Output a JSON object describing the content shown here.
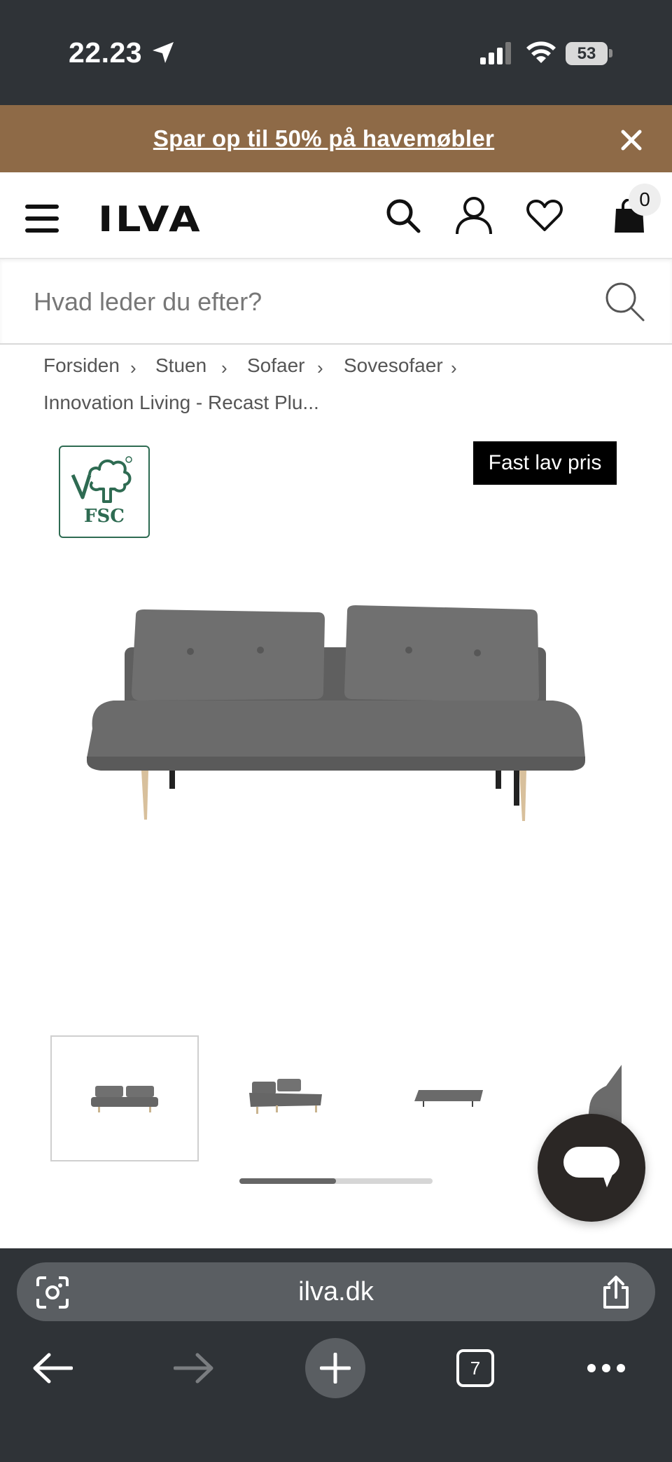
{
  "status_bar": {
    "time": "22.23",
    "battery": "53"
  },
  "promo": {
    "text": "Spar op til 50% på havemøbler"
  },
  "header": {
    "logo": "ILVA",
    "cart_count": "0"
  },
  "search": {
    "placeholder": "Hvad leder du efter?"
  },
  "breadcrumb": {
    "items": [
      "Forsiden",
      "Stuen",
      "Sofaer",
      "Sovesofaer",
      "Innovation Living - Recast Plu..."
    ],
    "separator": "›"
  },
  "badges": {
    "fsc": "FSC",
    "price_tag": "Fast lav pris"
  },
  "gallery": {
    "progress": 0.5
  },
  "browser": {
    "url": "ilva.dk",
    "tabs_count": "7"
  },
  "colors": {
    "promo_bg": "#8e6a47",
    "chrome": "#2f3337",
    "sofa": "#6e6e6e",
    "fsc_green": "#2e6b52"
  }
}
